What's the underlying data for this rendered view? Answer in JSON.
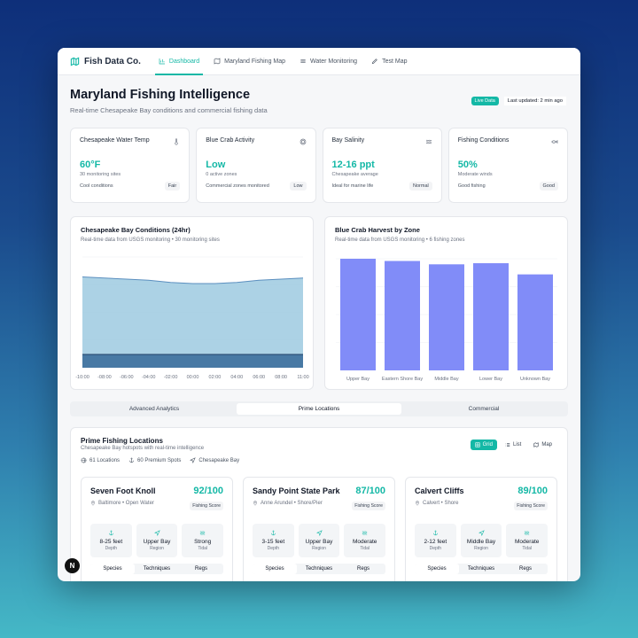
{
  "nav": {
    "brand": "Fish Data Co.",
    "links": [
      "Dashboard",
      "Maryland Fishing Map",
      "Water Monitoring",
      "Test Map"
    ]
  },
  "header": {
    "title": "Maryland Fishing Intelligence",
    "subtitle": "Real-time Chesapeake Bay conditions and commercial fishing data",
    "live_badge": "Live Data",
    "updated": "Last updated: 2 min ago"
  },
  "stats": [
    {
      "title": "Chesapeake Water Temp",
      "icon": "thermometer-icon",
      "value": "60°F",
      "sub": "30 monitoring sites",
      "foot": "Cool conditions",
      "badge": "Fair"
    },
    {
      "title": "Blue Crab Activity",
      "icon": "crab-icon",
      "value": "Low",
      "sub": "0 active zones",
      "foot": "Commercial zones monitored",
      "badge": "Low"
    },
    {
      "title": "Bay Salinity",
      "icon": "waves-icon",
      "value": "12-16 ppt",
      "sub": "Chesapeake average",
      "foot": "Ideal for marine life",
      "badge": "Normal"
    },
    {
      "title": "Fishing Conditions",
      "icon": "fish-icon",
      "value": "50%",
      "sub": "Moderate winds",
      "foot": "Good fishing",
      "badge": "Good"
    }
  ],
  "charts": {
    "conditions": {
      "title": "Chesapeake Bay Conditions (24hr)",
      "subtitle": "Real-time data from USGS monitoring • 30 monitoring sites"
    },
    "harvest": {
      "title": "Blue Crab Harvest by Zone",
      "subtitle": "Real-time data from USGS monitoring • 6 fishing zones"
    }
  },
  "chart_data": [
    {
      "type": "area",
      "title": "Chesapeake Bay Conditions (24hr)",
      "x": [
        "-10:00",
        "-08:00",
        "-06:00",
        "-04:00",
        "-02:00",
        "00:00",
        "02:00",
        "04:00",
        "06:00",
        "08:00",
        "11:00"
      ],
      "series": [
        {
          "values": [
            0.82,
            0.81,
            0.8,
            0.79,
            0.77,
            0.76,
            0.76,
            0.77,
            0.79,
            0.8,
            0.81
          ],
          "color": "#9ecae1"
        },
        {
          "values": [
            0.12,
            0.12,
            0.12,
            0.12,
            0.12,
            0.12,
            0.12,
            0.12,
            0.12,
            0.12,
            0.12
          ],
          "color": "#3d6f9c"
        }
      ],
      "ylim": [
        0,
        1
      ],
      "grid": true
    },
    {
      "type": "bar",
      "title": "Blue Crab Harvest by Zone",
      "categories": [
        "Upper Bay",
        "Eastern Shore Bay",
        "Middle Bay",
        "Lower Bay",
        "Unknown Bay"
      ],
      "values": [
        100,
        98,
        95,
        96,
        86
      ],
      "ylim": [
        0,
        100
      ],
      "color": "#818cf8",
      "grid": true
    }
  ],
  "tabs": [
    "Advanced Analytics",
    "Prime Locations",
    "Commercial"
  ],
  "locations": {
    "title": "Prime Fishing Locations",
    "subtitle": "Chesapeake Bay hotspots with real-time intelligence",
    "meta": [
      "61 Locations",
      "60 Premium Spots",
      "Chesapeake Bay"
    ],
    "views": [
      "Grid",
      "List",
      "Map"
    ],
    "score_label": "Fishing Score",
    "cards": [
      {
        "name": "Seven Foot Knoll",
        "score": "92/100",
        "area": "Baltimore • Open Water",
        "metrics": [
          {
            "v": "8-25 feet",
            "l": "Depth"
          },
          {
            "v": "Upper Bay",
            "l": "Region"
          },
          {
            "v": "Strong",
            "l": "Tidal"
          }
        ]
      },
      {
        "name": "Sandy Point State Park",
        "score": "87/100",
        "area": "Anne Arundel • Shore/Pier",
        "metrics": [
          {
            "v": "3-15 feet",
            "l": "Depth"
          },
          {
            "v": "Upper Bay",
            "l": "Region"
          },
          {
            "v": "Moderate",
            "l": "Tidal"
          }
        ]
      },
      {
        "name": "Calvert Cliffs",
        "score": "89/100",
        "area": "Calvert • Shore",
        "metrics": [
          {
            "v": "2-12 feet",
            "l": "Depth"
          },
          {
            "v": "Middle Bay",
            "l": "Region"
          },
          {
            "v": "Moderate",
            "l": "Tidal"
          }
        ]
      }
    ],
    "card_tabs": [
      "Species",
      "Techniques",
      "Regs"
    ]
  },
  "fab": "N"
}
